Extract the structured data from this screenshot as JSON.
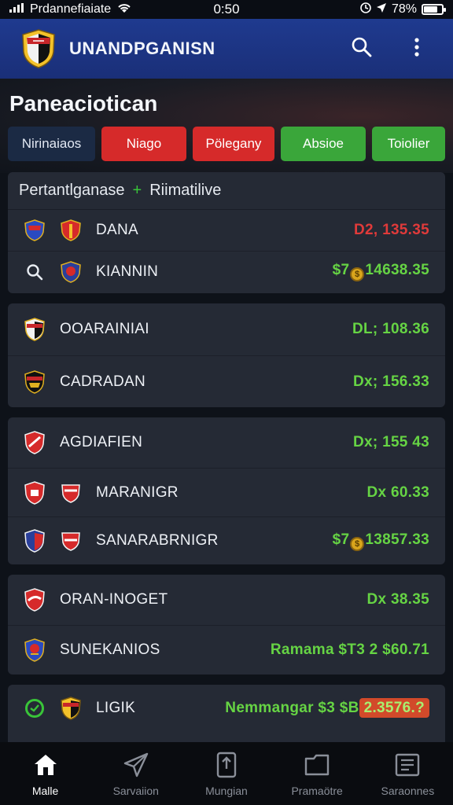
{
  "status_bar": {
    "carrier": "Prdannefiaiate",
    "time": "0:50",
    "battery": "78%",
    "battery_level": 0.78
  },
  "header": {
    "app_title": "UNANDPGANISN",
    "logo": "shield-logo-icon",
    "search_icon": "search-icon",
    "menu_icon": "kebab-menu-icon"
  },
  "page": {
    "title": "Paneaciotican"
  },
  "tabs": [
    {
      "label": "Nirinaiaos",
      "color": "#1b2a44"
    },
    {
      "label": "Niago",
      "color": "#d62a2a"
    },
    {
      "label": "Pölegany",
      "color": "#d62a2a"
    },
    {
      "label": "Absioe",
      "color": "#3aa63a"
    },
    {
      "label": "Toiolier",
      "color": "#3aa63a"
    }
  ],
  "sections": [
    {
      "header": {
        "left": "Pertantlganase",
        "right": "Riimatilive"
      },
      "rows": [
        {
          "icon": "shield-crest-icon",
          "name": "DANA",
          "value": "D2, 135.35",
          "tone": "red"
        },
        {
          "icon": "search-icon",
          "name": "KIANNIN",
          "value_prefix": "$7",
          "value_suffix": "14638.35",
          "tone": "green",
          "has_coin": true
        }
      ]
    },
    {
      "rows": [
        {
          "icon": "shield-crest-icon",
          "name": "OOARAINIAI",
          "value": "DL; 108.36",
          "tone": "green"
        },
        {
          "icon": "shield-crest-icon",
          "name": "CADRADAN",
          "value": "Dx; 156.33",
          "tone": "green"
        }
      ]
    },
    {
      "rows": [
        {
          "icon": "shield-crest-icon",
          "name": "AGDIAFIEN",
          "value": "Dx; 155 43",
          "tone": "green"
        },
        {
          "icon": "shield-crest-icon",
          "name": "MARANIGR",
          "value": "Dx 60.33",
          "tone": "green"
        },
        {
          "icon": "shield-crest-icon",
          "name": "SANARABRNIGR",
          "value_prefix": "$7",
          "value_suffix": "13857.33",
          "tone": "green",
          "has_coin": true
        }
      ]
    },
    {
      "rows": [
        {
          "icon": "shield-crest-icon",
          "name": "ORAN-INOGET",
          "value": "Dx 38.35",
          "tone": "green"
        },
        {
          "icon": "shield-crest-icon",
          "name": "SUNEKANIOS",
          "value": "Ramama $T3 2 $60.71",
          "tone": "green"
        }
      ]
    },
    {
      "rows": [
        {
          "icon": "check-circle-icon",
          "name": "LIGIK",
          "value_prefix": "Nemmangar $3 $B",
          "value_pill": "2.3576.?",
          "tone": "green"
        }
      ]
    }
  ],
  "bottom_nav": [
    {
      "label": "Malle",
      "icon": "home-icon",
      "active": true
    },
    {
      "label": "Sarvaiion",
      "icon": "send-icon",
      "active": false
    },
    {
      "label": "Mungian",
      "icon": "phone-upload-icon",
      "active": false
    },
    {
      "label": "Pramaötre",
      "icon": "folder-icon",
      "active": false
    },
    {
      "label": "Saraonnes",
      "icon": "document-icon",
      "active": false
    }
  ]
}
